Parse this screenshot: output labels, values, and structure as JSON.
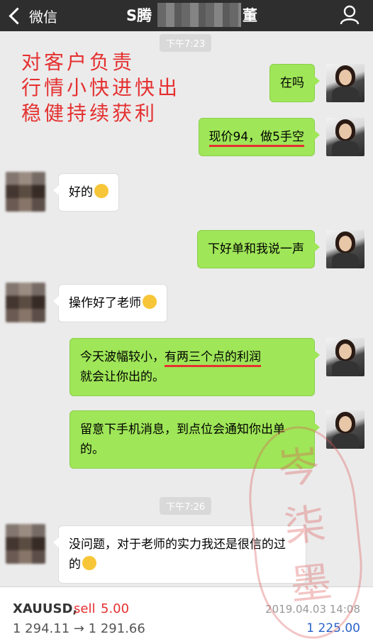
{
  "titlebar": {
    "back_label": "微信",
    "title_start": "S腾",
    "title_end": "董"
  },
  "timestamps": [
    "下午7:23",
    "下午7:26"
  ],
  "promo": {
    "lines": [
      "对客户负责",
      "行情小快进快出",
      "稳健持续获利"
    ]
  },
  "messages": [
    {
      "side": "right",
      "text": "在吗"
    },
    {
      "side": "right",
      "text": "现价94，做5手空"
    },
    {
      "side": "left",
      "text": "好的"
    },
    {
      "side": "right",
      "text": "下好单和我说一声"
    },
    {
      "side": "left",
      "text": "操作好了老师"
    },
    {
      "side": "right",
      "text_a": "今天波幅较小，",
      "text_b": "有两三个点的利润",
      "text_c": "就会让你出的。"
    },
    {
      "side": "right",
      "text": "留意下手机消息，到点位会通知你出单的。"
    },
    {
      "side": "left",
      "text": "没问题，对于老师的实力我还是很信的过的"
    }
  ],
  "trade": {
    "symbol": "XAUUSD,",
    "side": "sell",
    "lots": "5.00",
    "prices": "1 294.11 → 1 291.66",
    "datetime": "2019.04.03 14:08",
    "profit": "1 225.00"
  },
  "stamp": {
    "text": "岑柒墨"
  },
  "colors": {
    "accent_red": "#e53030",
    "bubble_green": "#9fe658",
    "profit_blue": "#2a62c9"
  },
  "icons": [
    "back-chevron-icon",
    "person-icon",
    "ok-hand-emoji",
    "grin-emoji",
    "thumbs-up-emoji"
  ]
}
